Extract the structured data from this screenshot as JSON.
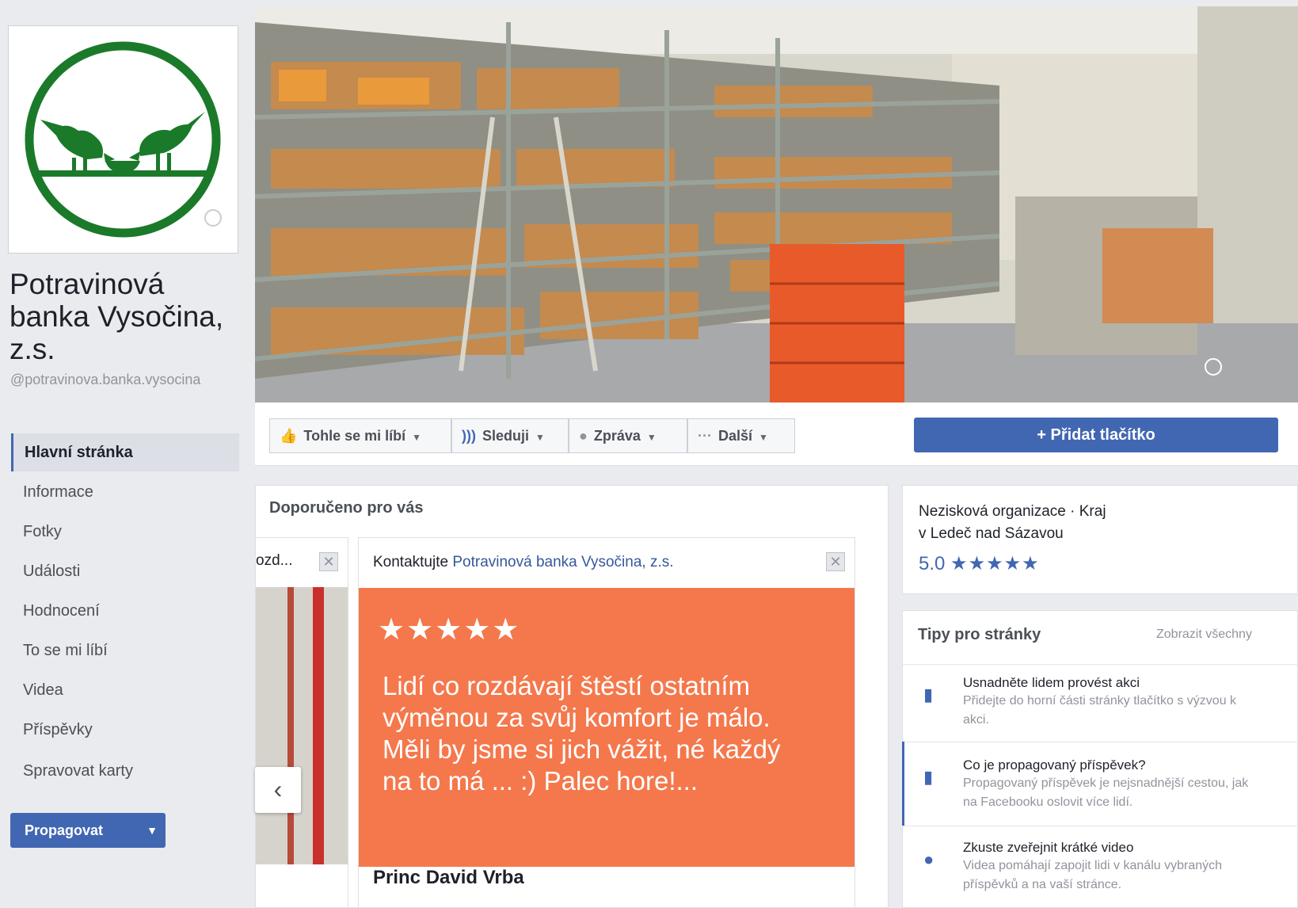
{
  "page": {
    "name": "Potravinová banka Vysočina, z.s.",
    "handle": "@potravinova.banka.vysocina"
  },
  "sidebar": {
    "items": [
      {
        "label": "Hlavní stránka",
        "active": true
      },
      {
        "label": "Informace"
      },
      {
        "label": "Fotky"
      },
      {
        "label": "Události"
      },
      {
        "label": "Hodnocení"
      },
      {
        "label": "To se mi líbí"
      },
      {
        "label": "Videa"
      },
      {
        "label": "Příspěvky"
      },
      {
        "label": "Spravovat karty"
      }
    ],
    "promote_label": "Propagovat"
  },
  "actions": {
    "like": "Tohle se mi líbí",
    "follow": "Sleduji",
    "message": "Zpráva",
    "more": "Další",
    "add_button": "+ Přidat tlačítko"
  },
  "recommended": {
    "title": "Doporučeno pro vás",
    "left_card_title": "ozd...",
    "card_prefix": "Kontaktujte ",
    "card_link": "Potravinová banka Vysočina, z.s.",
    "stars": "★★★★★",
    "review_text": "Lidí co rozdávají štěstí ostatním výměnou za svůj komfort je málo. Měli by jsme si jich vážit, né každý na to má ... :) Palec hore!...",
    "reviewer": "Princ David Vrba"
  },
  "about": {
    "category": "Nezisková organizace · Kraj",
    "location": "v Ledeč nad Sázavou",
    "rating": "5.0",
    "stars": "★★★★★"
  },
  "tips": {
    "title": "Tipy pro stránky",
    "see_all": "Zobrazit všechny",
    "items": [
      {
        "title": "Usnadněte lidem provést akci",
        "desc": "Přidejte do horní části stránky tlačítko s výzvou k akci.",
        "icon": "bar-chart-icon"
      },
      {
        "title": "Co je propagovaný příspěvek?",
        "desc": "Propagovaný příspěvek je nejsnadnější cestou, jak na Facebooku oslovit více lidí.",
        "icon": "bar-chart-icon"
      },
      {
        "title": "Zkuste zveřejnit krátké video",
        "desc": "Videa pomáhají zapojit lidi v kanálu vybraných příspěvků a na vaší stránce.",
        "icon": "lightbulb-icon"
      }
    ]
  },
  "colors": {
    "brand": "#4267b2",
    "logo_green": "#1a7a2a",
    "review_bg": "#f4784c"
  }
}
